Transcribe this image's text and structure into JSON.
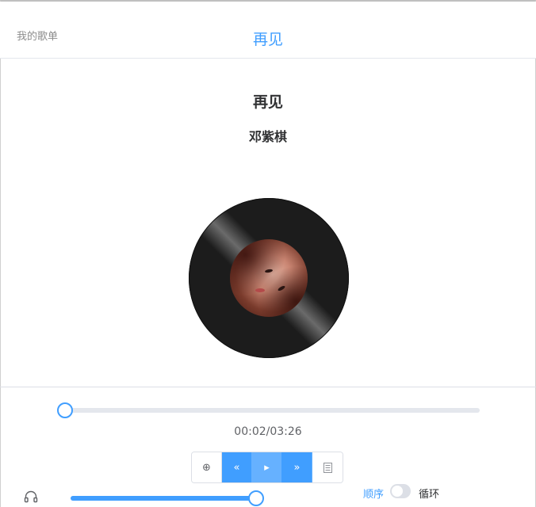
{
  "header": {
    "my_playlist": "我的歌单",
    "title": "再见"
  },
  "song": {
    "title": "再见",
    "artist": "邓紫棋",
    "cover_icon": "album-cover-photo"
  },
  "playback": {
    "current_time": "00:02",
    "duration": "03:26",
    "time_display": "00:02/03:26",
    "progress_fraction": 0.0097
  },
  "controls": {
    "add_icon": "plus-circle-icon",
    "prev_icon": "double-chevron-left-icon",
    "play_icon": "play-icon",
    "next_icon": "double-chevron-right-icon",
    "list_icon": "document-list-icon",
    "add_glyph": "⊕",
    "prev_glyph": "«",
    "play_glyph": "▸",
    "next_glyph": "»"
  },
  "volume": {
    "icon": "headphones-icon",
    "level_fraction": 1.0
  },
  "play_mode": {
    "order_label": "顺序",
    "loop_label": "循环",
    "loop_enabled": false
  },
  "colors": {
    "accent": "#409eff",
    "accent_light": "#66b1ff",
    "track": "#e4e7ed",
    "record": "#1c1c1c"
  }
}
